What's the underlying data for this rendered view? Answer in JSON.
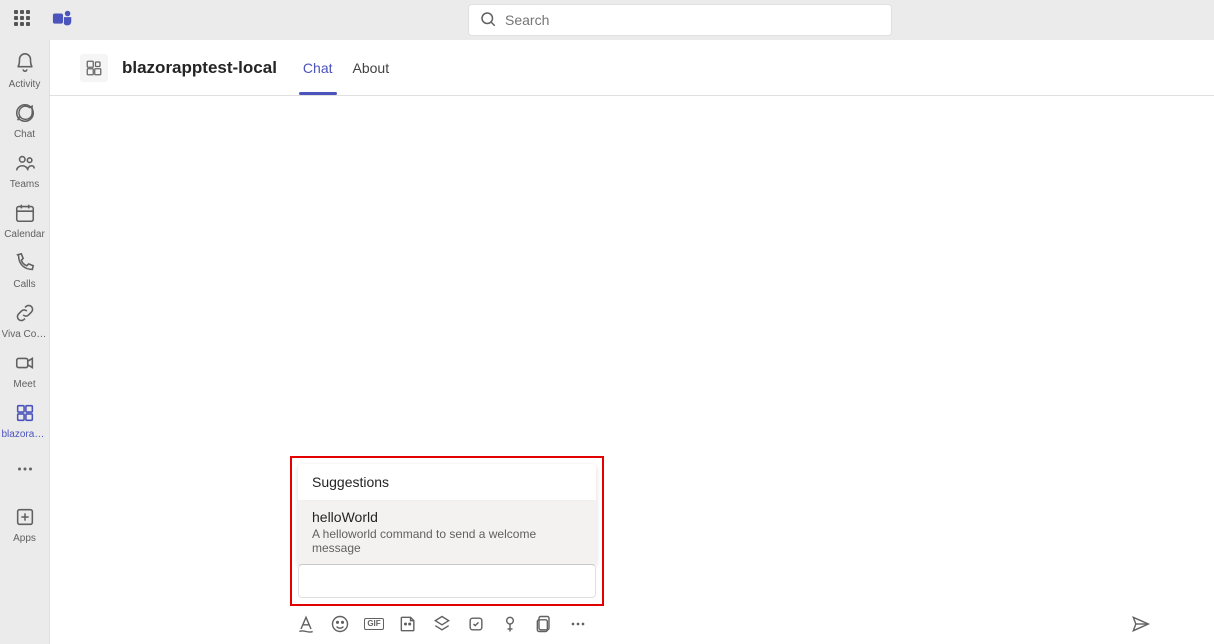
{
  "top": {
    "search_placeholder": "Search"
  },
  "sidebar": {
    "items": [
      {
        "label": "Activity"
      },
      {
        "label": "Chat"
      },
      {
        "label": "Teams"
      },
      {
        "label": "Calendar"
      },
      {
        "label": "Calls"
      },
      {
        "label": "Viva Connec..."
      },
      {
        "label": "Meet"
      },
      {
        "label": "blazorappt..."
      }
    ],
    "apps_label": "Apps"
  },
  "header": {
    "title": "blazorapptest-local",
    "tabs": [
      {
        "label": "Chat"
      },
      {
        "label": "About"
      }
    ]
  },
  "suggestions": {
    "heading": "Suggestions",
    "items": [
      {
        "command": "helloWorld",
        "description": "A helloworld command to send a welcome message"
      }
    ]
  },
  "toolbar": {
    "gif_label": "GIF"
  }
}
